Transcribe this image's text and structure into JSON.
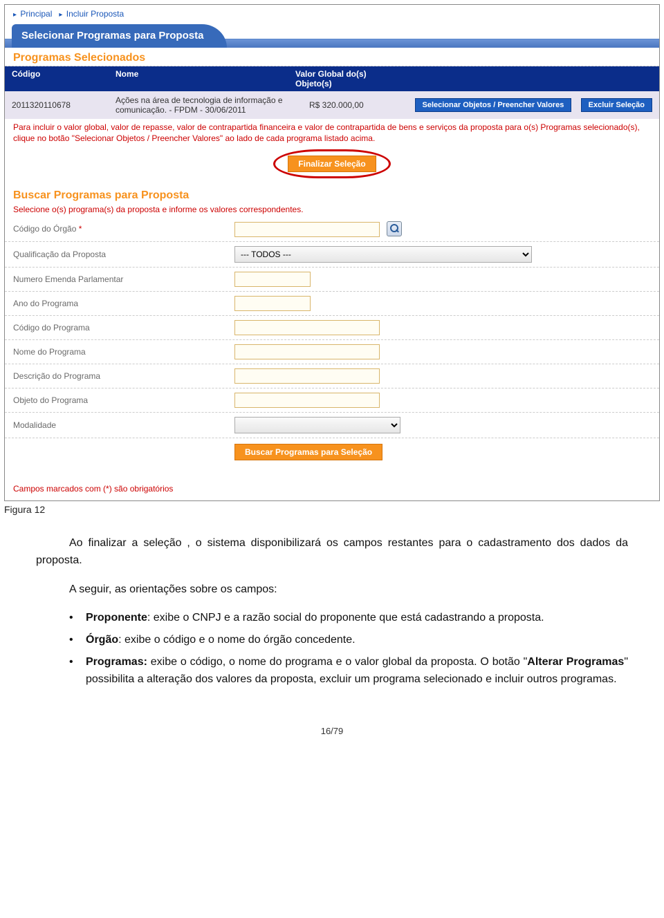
{
  "breadcrumb": {
    "principal": "Principal",
    "incluir": "Incluir Proposta"
  },
  "ribbon": {
    "title": "Selecionar Programas para Proposta"
  },
  "section1_title": "Programas Selecionados",
  "table": {
    "h_codigo": "Código",
    "h_nome": "Nome",
    "h_valor": "Valor Global do(s) Objeto(s)",
    "row": {
      "codigo": "2011320110678",
      "nome": "Ações na área de tecnologia de informação e comunicação. - FPDM - 30/06/2011",
      "valor": "R$ 320.000,00",
      "btn_selecionar": "Selecionar Objetos / Preencher Valores",
      "btn_excluir": "Excluir Seleção"
    }
  },
  "note_red": "Para incluir o valor global, valor de repasse, valor de contrapartida financeira e valor de contrapartida de bens e serviços da proposta para o(s) Programas selecionado(s), clique no botão \"Selecionar Objetos / Preencher Valores\" ao lado de cada programa listado acima.",
  "btn_finalizar": "Finalizar Seleção",
  "section2_title": "Buscar Programas para Proposta",
  "section2_instr": "Selecione o(s) programa(s) da proposta e informe os valores correspondentes.",
  "form": {
    "codigo_orgao": "Código do Órgão",
    "qualificacao": "Qualificação da Proposta",
    "qualificacao_val": "--- TODOS ---",
    "numero_emenda": "Numero Emenda Parlamentar",
    "ano_programa": "Ano do Programa",
    "codigo_programa": "Código do Programa",
    "nome_programa": "Nome do Programa",
    "descricao_programa": "Descrição do Programa",
    "objeto_programa": "Objeto do Programa",
    "modalidade": "Modalidade"
  },
  "btn_buscar": "Buscar Programas para Seleção",
  "req_note": "Campos marcados com (*) são obrigatórios",
  "caption": "Figura 12",
  "body": {
    "p1": "Ao finalizar a seleção , o sistema disponibilizará os campos restantes para o cadastramento dos dados da proposta.",
    "p2": "A seguir, as orientações sobre os campos:",
    "b1a": "Proponente",
    "b1b": ": exibe o CNPJ e a razão social do proponente que está cadastrando a proposta.",
    "b2a": "Órgão",
    "b2b": ": exibe o código e o nome do órgão concedente.",
    "b3a": "Programas:",
    "b3b": " exibe o código, o nome do programa e o valor global da proposta. O botão \"",
    "b3c": "Alterar Programas",
    "b3d": "\" possibilita a alteração dos valores da proposta, excluir um programa selecionado e incluir outros programas."
  },
  "pagenum": "16/79"
}
